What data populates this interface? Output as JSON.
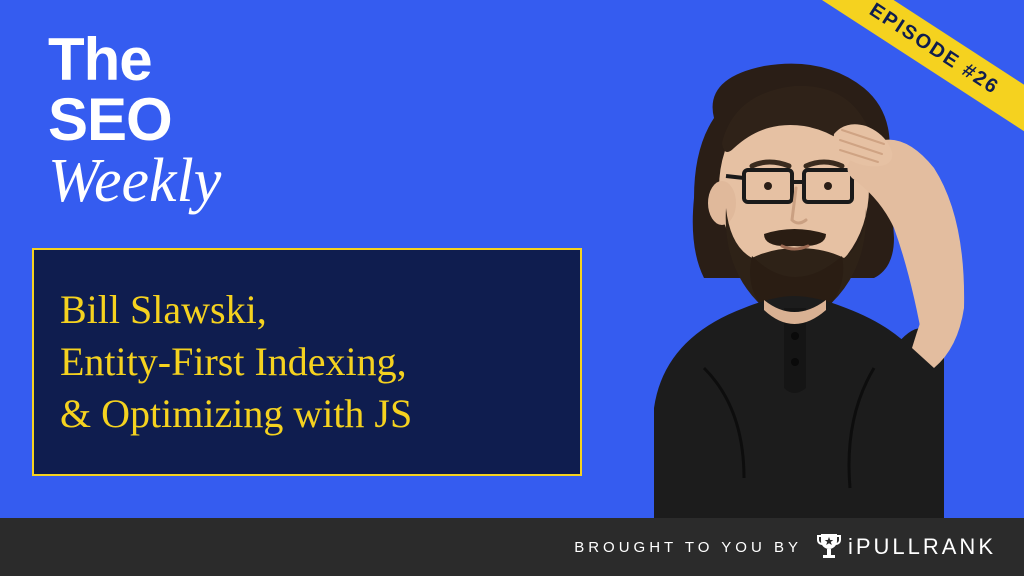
{
  "show": {
    "line1": "The",
    "line2": "SEO",
    "line3": "Weekly"
  },
  "ribbon": {
    "label": "EPISODE #26"
  },
  "topics": {
    "text": "Bill Slawski,\nEntity-First Indexing,\n& Optimizing with JS"
  },
  "footer": {
    "prefix": "BROUGHT TO YOU BY",
    "brand": "iPULLRANK"
  },
  "colors": {
    "background": "#355cf0",
    "accent_yellow": "#f5d21f",
    "topic_bg": "#0f1d4f",
    "footer_bg": "#2b2b2b",
    "white": "#ffffff"
  }
}
